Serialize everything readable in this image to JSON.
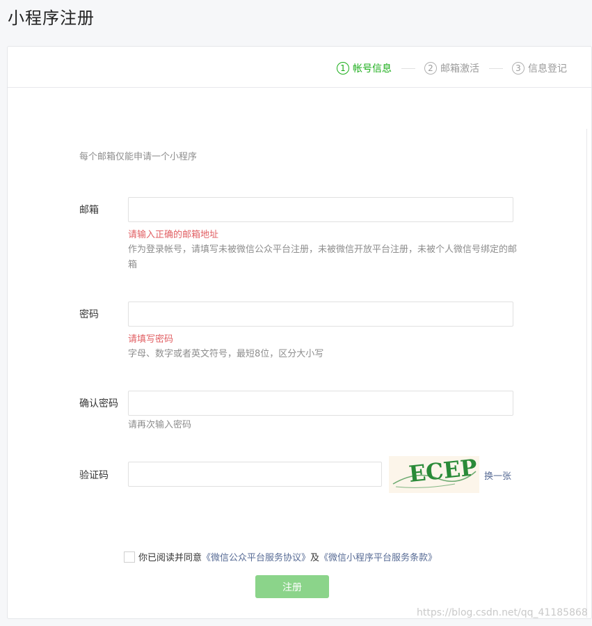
{
  "header": {
    "title": "小程序注册"
  },
  "steps": [
    {
      "num": "1",
      "label": "帐号信息",
      "active": true
    },
    {
      "num": "2",
      "label": "邮箱激活",
      "active": false
    },
    {
      "num": "3",
      "label": "信息登记",
      "active": false
    }
  ],
  "form": {
    "notice": "每个邮箱仅能申请一个小程序",
    "email": {
      "label": "邮箱",
      "value": "",
      "error": "请输入正确的邮箱地址",
      "tip": "作为登录帐号，请填写未被微信公众平台注册，未被微信开放平台注册，未被个人微信号绑定的邮箱"
    },
    "password": {
      "label": "密码",
      "value": "",
      "error": "请填写密码",
      "tip": "字母、数字或者英文符号，最短8位，区分大小写"
    },
    "confirm": {
      "label": "确认密码",
      "value": "",
      "tip": "请再次输入密码"
    },
    "captcha": {
      "label": "验证码",
      "value": "",
      "image_text": "ECEP",
      "refresh": "换一张"
    },
    "agreement": {
      "prefix": "你已阅读并同意",
      "link1": "《微信公众平台服务协议》",
      "middle": "及",
      "link2": "《微信小程序平台服务条款》",
      "checked": false
    },
    "submit": "注册"
  },
  "watermark": "https://blog.csdn.net/qq_41185868",
  "colors": {
    "accent": "#1aad19",
    "error": "#e15f63",
    "link": "#576b95",
    "button_disabled": "#8bd48a"
  }
}
